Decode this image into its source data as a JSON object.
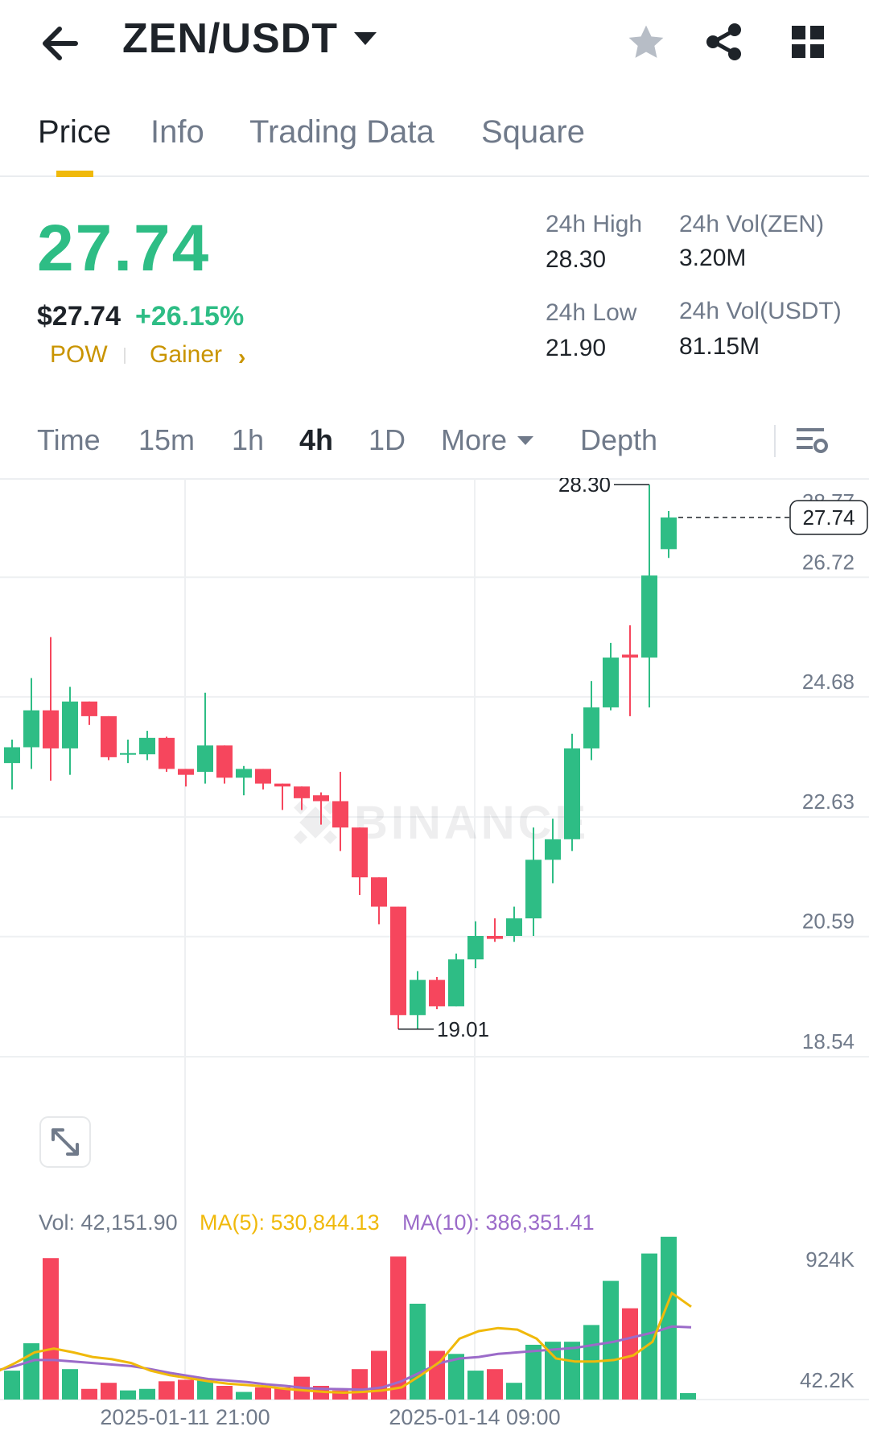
{
  "header": {
    "pair": "ZEN/USDT",
    "icons": [
      "back-arrow-icon",
      "caret-down-icon",
      "star-icon",
      "share-icon",
      "grid-icon"
    ]
  },
  "tabs": [
    "Price",
    "Info",
    "Trading Data",
    "Square"
  ],
  "ticker": {
    "last_price": "27.74",
    "usd_price": "$27.74",
    "change": "+26.15%",
    "tags": [
      "POW",
      "Gainer"
    ],
    "high_label": "24h High",
    "high": "28.30",
    "low_label": "24h Low",
    "low": "21.90",
    "vol_base_label": "24h Vol(ZEN)",
    "vol_base": "3.20M",
    "vol_quote_label": "24h Vol(USDT)",
    "vol_quote": "81.15M"
  },
  "intervals": [
    "Time",
    "15m",
    "1h",
    "4h",
    "1D",
    "More",
    "Depth"
  ],
  "colors": {
    "up": "#2ebd85",
    "down": "#f6465d",
    "accent": "#f0b90b",
    "ma5": "#f0b90b",
    "ma10": "#9b6bc9"
  },
  "chart_data": {
    "type": "candlestick",
    "price_axis": [
      28.77,
      26.72,
      24.68,
      22.63,
      20.59,
      18.54
    ],
    "ylim": [
      18.54,
      28.77
    ],
    "last_price_marker": "27.74",
    "high_marker": "28.30",
    "low_marker": "19.01",
    "x_labels": [
      "2025-01-11 21:00",
      "2025-01-14 09:00"
    ],
    "watermark": "BINANCE",
    "candles": [
      {
        "o": 23.55,
        "h": 23.95,
        "l": 23.1,
        "c": 23.82
      },
      {
        "o": 23.82,
        "h": 25.0,
        "l": 23.45,
        "c": 24.45
      },
      {
        "o": 24.45,
        "h": 25.7,
        "l": 23.25,
        "c": 23.8
      },
      {
        "o": 23.8,
        "h": 24.85,
        "l": 23.35,
        "c": 24.6
      },
      {
        "o": 24.6,
        "h": 24.6,
        "l": 24.2,
        "c": 24.35
      },
      {
        "o": 24.35,
        "h": 24.35,
        "l": 23.6,
        "c": 23.65
      },
      {
        "o": 23.7,
        "h": 23.95,
        "l": 23.55,
        "c": 23.72
      },
      {
        "o": 23.7,
        "h": 24.1,
        "l": 23.6,
        "c": 23.98
      },
      {
        "o": 23.98,
        "h": 24.0,
        "l": 23.4,
        "c": 23.45
      },
      {
        "o": 23.45,
        "h": 23.45,
        "l": 23.15,
        "c": 23.35
      },
      {
        "o": 23.4,
        "h": 24.75,
        "l": 23.2,
        "c": 23.85
      },
      {
        "o": 23.85,
        "h": 23.85,
        "l": 23.2,
        "c": 23.3
      },
      {
        "o": 23.3,
        "h": 23.5,
        "l": 23.0,
        "c": 23.45
      },
      {
        "o": 23.45,
        "h": 23.45,
        "l": 23.1,
        "c": 23.2
      },
      {
        "o": 23.2,
        "h": 23.2,
        "l": 22.75,
        "c": 23.15
      },
      {
        "o": 23.15,
        "h": 23.15,
        "l": 22.75,
        "c": 22.95
      },
      {
        "o": 23.0,
        "h": 23.05,
        "l": 22.5,
        "c": 22.9
      },
      {
        "o": 22.9,
        "h": 23.4,
        "l": 22.05,
        "c": 22.45
      },
      {
        "o": 22.45,
        "h": 22.45,
        "l": 21.3,
        "c": 21.6
      },
      {
        "o": 21.6,
        "h": 21.6,
        "l": 20.8,
        "c": 21.1
      },
      {
        "o": 21.1,
        "h": 21.1,
        "l": 19.01,
        "c": 19.25
      },
      {
        "o": 19.25,
        "h": 20.0,
        "l": 19.01,
        "c": 19.85
      },
      {
        "o": 19.85,
        "h": 19.9,
        "l": 19.35,
        "c": 19.4
      },
      {
        "o": 19.4,
        "h": 20.3,
        "l": 19.4,
        "c": 20.2
      },
      {
        "o": 20.2,
        "h": 20.85,
        "l": 20.05,
        "c": 20.6
      },
      {
        "o": 20.6,
        "h": 20.9,
        "l": 20.5,
        "c": 20.55
      },
      {
        "o": 20.6,
        "h": 21.1,
        "l": 20.5,
        "c": 20.9
      },
      {
        "o": 20.9,
        "h": 22.45,
        "l": 20.6,
        "c": 21.9
      },
      {
        "o": 21.9,
        "h": 22.6,
        "l": 21.5,
        "c": 22.25
      },
      {
        "o": 22.25,
        "h": 24.05,
        "l": 22.05,
        "c": 23.8
      },
      {
        "o": 23.8,
        "h": 24.95,
        "l": 23.6,
        "c": 24.5
      },
      {
        "o": 24.5,
        "h": 25.6,
        "l": 24.45,
        "c": 25.35
      },
      {
        "o": 25.4,
        "h": 25.9,
        "l": 24.35,
        "c": 25.35
      },
      {
        "o": 25.35,
        "h": 28.3,
        "l": 24.5,
        "c": 26.75
      },
      {
        "o": 27.2,
        "h": 27.85,
        "l": 27.05,
        "c": 27.74
      }
    ],
    "volume_panel": {
      "vol_label": "Vol: 42,151.90",
      "ma5_label": "MA(5): 530,844.13",
      "ma10_label": "MA(10): 386,351.41",
      "axis": [
        "924K",
        "42.2K"
      ],
      "ylim": [
        0,
        1000000
      ],
      "volumes": [
        190000,
        370000,
        930000,
        200000,
        70000,
        110000,
        60000,
        70000,
        120000,
        130000,
        130000,
        90000,
        50000,
        80000,
        80000,
        150000,
        90000,
        60000,
        200000,
        320000,
        940000,
        630000,
        320000,
        300000,
        190000,
        200000,
        110000,
        360000,
        380000,
        380000,
        490000,
        780000,
        600000,
        960000,
        1070000,
        42151.9
      ],
      "ma5": [
        180000,
        240000,
        310000,
        335000,
        310000,
        280000,
        265000,
        240000,
        190000,
        160000,
        140000,
        120000,
        105000,
        95000,
        85000,
        70000,
        60000,
        50000,
        45000,
        50000,
        60000,
        80000,
        160000,
        250000,
        400000,
        450000,
        470000,
        460000,
        400000,
        270000,
        250000,
        250000,
        260000,
        290000,
        380000,
        700000,
        610000
      ],
      "ma10": [
        190000,
        220000,
        260000,
        260000,
        250000,
        240000,
        230000,
        220000,
        200000,
        175000,
        155000,
        135000,
        125000,
        115000,
        100000,
        90000,
        75000,
        70000,
        68000,
        65000,
        80000,
        120000,
        180000,
        240000,
        270000,
        280000,
        300000,
        310000,
        320000,
        330000,
        340000,
        360000,
        380000,
        410000,
        440000,
        480000,
        475000
      ]
    }
  }
}
